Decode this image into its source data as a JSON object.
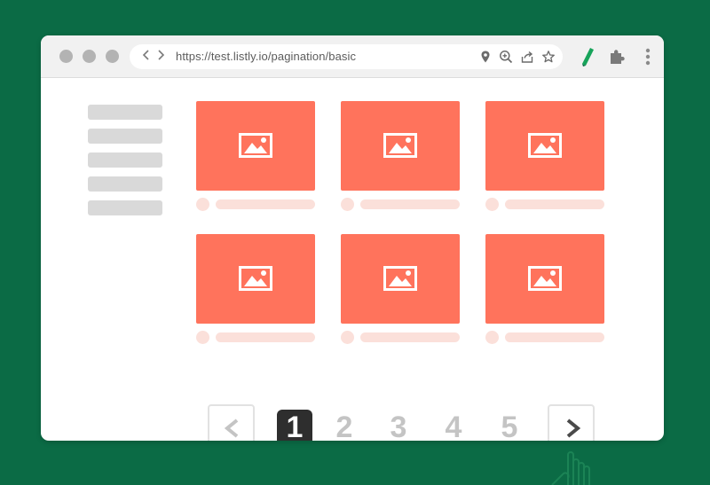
{
  "browser": {
    "url": "https://test.listly.io/pagination/basic",
    "nav": {
      "back_icon": "chevron-left-icon",
      "forward_icon": "chevron-right-icon"
    },
    "address_icons": [
      "location-pin-icon",
      "zoom-icon",
      "share-icon",
      "star-icon"
    ],
    "toolbar_icons": [
      "listly-extension-icon",
      "puzzle-icon",
      "kebab-menu-icon"
    ],
    "colors": {
      "window_dots": "#b3b3b3",
      "page_bg": "#0b6b45"
    }
  },
  "sidebar": {
    "placeholder_rows": 5
  },
  "grid": {
    "cards": [
      {
        "icon": "image-icon"
      },
      {
        "icon": "image-icon"
      },
      {
        "icon": "image-icon"
      },
      {
        "icon": "image-icon"
      },
      {
        "icon": "image-icon"
      },
      {
        "icon": "image-icon"
      }
    ],
    "colors": {
      "thumbnail": "#ff735c",
      "placeholder": "#fbe0da"
    }
  },
  "pagination": {
    "prev_label": "<",
    "next_label": ">",
    "pages": [
      "1",
      "2",
      "3",
      "4",
      "5"
    ],
    "current_page": "1",
    "colors": {
      "active_bg": "#2e2e2e",
      "inactive_text": "#c4c4c4"
    }
  }
}
